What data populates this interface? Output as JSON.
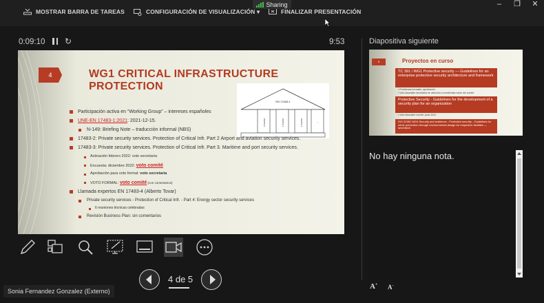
{
  "topbar": {
    "taskbar_label": "MOSTRAR BARRA DE TAREAS",
    "display_settings_label": "CONFIGURACIÓN DE VISUALIZACIÓN ▾",
    "end_show_label": "FINALIZAR PRESENTACIÓN",
    "sharing_label": "Sharing"
  },
  "presenter": {
    "elapsed": "0:09:10",
    "clock": "9:53",
    "page_counter": "4 de 5",
    "user_name": "Sonia Fernandez Gonzalez (Externo)"
  },
  "current_slide": {
    "number": "4",
    "title": "WG1 CRITICAL INFRASTRUCTURE PROTECTION",
    "b1": "Participación activa en “Working Group” – intereses españoles",
    "b2_link": "UNE-EN 17483-1:2021",
    "b2_rest": ": 2021-12-15.",
    "b3": "N-149: Briefing Note – traducción informal (NBS)",
    "b4": "17483-2: Private security services. Protection of Critical Infr. Part 2 Airport and aviation security services.",
    "b5": "17483-3: Private security services. Protection of Critical Infr. Part 3. Maritime and port security services.",
    "b6": "Activación febrero 2022: voto secretaría",
    "b7_pre": "Encuesta: diciembre 2022: ",
    "b7_link": "voto comité",
    "b8_pre": "Aprobación para voto formal: ",
    "b8_bold": "voto secretaría",
    "b9_pre": "VOTO FORMAL: ",
    "b9_link": "voto comité",
    "b9_post": " (con comentarios)",
    "b10": "Llamada expertos EN 17483-4 (Alberto Tovar)",
    "b11": "Private security services - Protection of Critical Infr. - Part 4: Energy sector security services",
    "b12": "6 reuniones técnicas celebradas",
    "b13": "Revisión Business Plan: sin comentarios",
    "house_roof": "EN 17483-1",
    "pillar_1": "PARTE 2",
    "pillar_2": "PARTE 3",
    "pillar_3": "PARTE 4",
    "pillar_4": "..."
  },
  "next_slide": {
    "panel_label": "Diapositiva siguiente",
    "number": "5",
    "title": "Proyectos en curso",
    "box1": "TC 391 / WG1 Protective security — Guidelines for an enterprise protective security architecture and framework",
    "box1_note1": "• Problemas formales: aprobación",
    "box1_note2": "• Voto favorable secretaría en atención a enmiendas votos del comité",
    "box2": "Protective Security - Guidelines for the development of a security plan for an organization",
    "box2_note": "• Voto favorable comité: junio 2022",
    "box3": "ISO 22351 WG4 Security and resilience - Protective security - Guidelines for crime prevention through environmental design for respective facilities — secretaría"
  },
  "notes": {
    "text": "No hay ninguna nota."
  }
}
